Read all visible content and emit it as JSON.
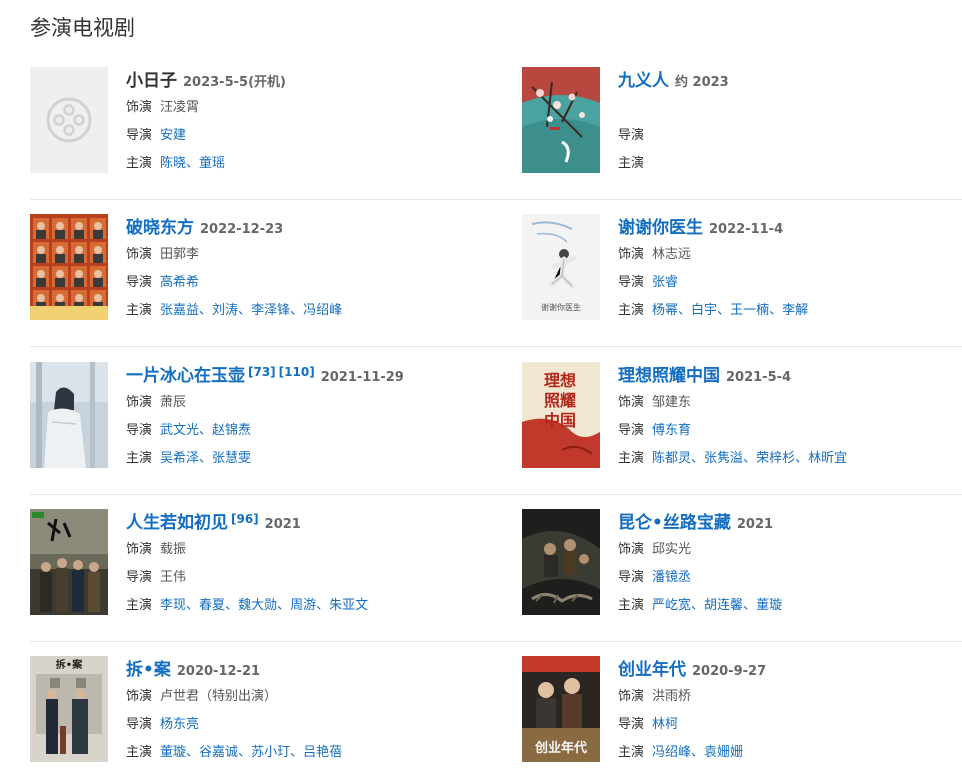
{
  "section": {
    "title": "参演电视剧"
  },
  "rows": [
    {
      "left": {
        "title": "小日子",
        "title_is_link": false,
        "sups": [],
        "date": "2023-5-5(开机)",
        "role_label": "饰演",
        "role": "汪凌霄",
        "director_label": "导演",
        "directors": [
          "安建"
        ],
        "cast_label": "主演",
        "cast": [
          "陈晓",
          "童瑶"
        ],
        "poster": "placeholder"
      },
      "right": {
        "title": "九义人",
        "title_is_link": true,
        "sups": [],
        "date": "约 2023",
        "role_label": "",
        "role": "",
        "director_label": "导演",
        "directors": [],
        "cast_label": "主演",
        "cast": [],
        "poster": "jiuyiren"
      }
    },
    {
      "left": {
        "title": "破晓东方",
        "title_is_link": true,
        "sups": [],
        "date": "2022-12-23",
        "role_label": "饰演",
        "role": "田郭李",
        "director_label": "导演",
        "directors": [
          "高希希"
        ],
        "cast_label": "主演",
        "cast": [
          "张嘉益",
          "刘涛",
          "李泽锋",
          "冯绍峰"
        ],
        "poster": "poxiao"
      },
      "right": {
        "title": "谢谢你医生",
        "title_is_link": true,
        "sups": [],
        "date": "2022-11-4",
        "role_label": "饰演",
        "role": "林志远",
        "director_label": "导演",
        "directors": [
          "张睿"
        ],
        "cast_label": "主演",
        "cast": [
          "杨幂",
          "白宇",
          "王一楠",
          "李解"
        ],
        "poster": "xiexie",
        "poster_text": "谢谢你医生"
      }
    },
    {
      "left": {
        "title": "一片冰心在玉壶",
        "title_is_link": true,
        "sups": [
          "[73]",
          "[110]"
        ],
        "date": "2021-11-29",
        "role_label": "饰演",
        "role": "萧辰",
        "director_label": "导演",
        "directors": [
          "武文光",
          "赵锦焘"
        ],
        "cast_label": "主演",
        "cast": [
          "吴希泽",
          "张慧雯"
        ],
        "poster": "bingxin"
      },
      "right": {
        "title": "理想照耀中国",
        "title_is_link": true,
        "sups": [],
        "date": "2021-5-4",
        "role_label": "饰演",
        "role": "邹建东",
        "director_label": "导演",
        "directors": [
          "傅东育"
        ],
        "cast_label": "主演",
        "cast": [
          "陈都灵",
          "张隽溢",
          "荣梓杉",
          "林昕宜"
        ],
        "poster": "lixiang",
        "poster_text": [
          "理想",
          "照耀",
          "中国"
        ]
      }
    },
    {
      "left": {
        "title": "人生若如初见",
        "title_is_link": true,
        "sups": [
          "[96]"
        ],
        "date": "2021",
        "role_label": "饰演",
        "role": "载振",
        "director_label": "导演",
        "directors": [
          "王伟"
        ],
        "directors_are_links": false,
        "cast_label": "主演",
        "cast": [
          "李现",
          "春夏",
          "魏大勋",
          "周游",
          "朱亚文"
        ],
        "poster": "rensheng"
      },
      "right": {
        "title": "昆仑•丝路宝藏",
        "title_is_link": true,
        "sups": [],
        "date": "2021",
        "role_label": "饰演",
        "role": "邱实光",
        "director_label": "导演",
        "directors": [
          "潘镜丞"
        ],
        "cast_label": "主演",
        "cast": [
          "严屹宽",
          "胡连馨",
          "董璇"
        ],
        "poster": "kunlun"
      }
    },
    {
      "left": {
        "title": "拆•案",
        "title_is_link": true,
        "sups": [],
        "date": "2020-12-21",
        "role_label": "饰演",
        "role": "卢世君（特别出演）",
        "director_label": "导演",
        "directors": [
          "杨东亮"
        ],
        "cast_label": "主演",
        "cast": [
          "董璇",
          "谷嘉诚",
          "苏小玎",
          "吕艳蓓"
        ],
        "poster": "chaian",
        "poster_text": "拆•案"
      },
      "right": {
        "title": "创业年代",
        "title_is_link": true,
        "sups": [],
        "date": "2020-9-27",
        "role_label": "饰演",
        "role": "洪雨桥",
        "director_label": "导演",
        "directors": [
          "林柯"
        ],
        "cast_label": "主演",
        "cast": [
          "冯绍峰",
          "袁姗姗"
        ],
        "poster": "chuangye",
        "poster_text": "创业年代"
      }
    }
  ],
  "colors": {
    "link": "#136ec2",
    "title_plain": "#333333",
    "date": "#666666",
    "divider": "#e6e6e6"
  }
}
